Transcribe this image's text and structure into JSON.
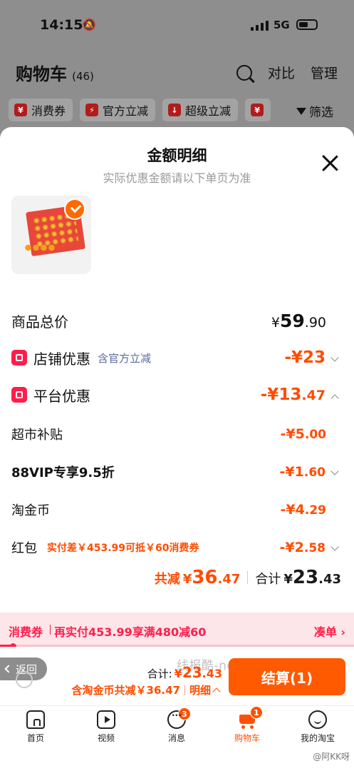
{
  "status_bar": {
    "time": "14:15",
    "network": "5G"
  },
  "cart_header": {
    "title": "购物车",
    "count": "(46)",
    "compare": "对比",
    "manage": "管理"
  },
  "filter_chips": [
    {
      "icon_text": "¥",
      "label": "消费券"
    },
    {
      "icon_text": "⚡",
      "label": "官方立减"
    },
    {
      "icon_text": "↓",
      "label": "超级立减"
    },
    {
      "icon_text": "¥",
      "label": ""
    }
  ],
  "filter_label": "筛选",
  "sheet": {
    "title": "金额明细",
    "subtitle": "实际优惠金额请以下单页为准",
    "total_price": {
      "label": "商品总价",
      "currency": "¥",
      "int": "59",
      "dec": ".90"
    },
    "shop_discount": {
      "label": "店铺优惠",
      "note": "含官方立减",
      "amount": "-¥23"
    },
    "platform_discount": {
      "label": "平台优惠",
      "amount_int": "-¥13",
      "amount_dec": ".47"
    },
    "items": [
      {
        "label": "超市补贴",
        "amount_int": "-¥5",
        "amount_dec": ".00",
        "note": "",
        "chevron": false
      },
      {
        "label": "88VIP专享9.5折",
        "amount_int": "-¥1",
        "amount_dec": ".60",
        "note": "",
        "chevron": true
      },
      {
        "label": "淘金币",
        "amount_int": "-¥4",
        "amount_dec": ".29",
        "note": "",
        "chevron": false
      },
      {
        "label": "红包",
        "amount_int": "-¥2",
        "amount_dec": ".58",
        "note": "实付差￥453.99可抵￥60消费券",
        "chevron": true
      }
    ],
    "summary": {
      "saved_label": "共减",
      "saved_currency": "¥",
      "saved_int": "36",
      "saved_dec": ".47",
      "total_label": "合计",
      "total_currency": "¥",
      "total_int": "23",
      "total_dec": ".43"
    }
  },
  "coupon_bar": {
    "tag": "消费券",
    "message": "再实付453.99享满480减60",
    "link": "凑单 ›",
    "progress": 0.04
  },
  "checkout": {
    "back_label": "返回",
    "sum_label": "合计:",
    "sum_currency": "¥",
    "sum_int": "23",
    "sum_dec": ".43",
    "saved_text": "含淘金币共减￥36.47",
    "detail_label": "明细",
    "pay_button": "结算(1)",
    "watermark": "线报酷-new.xianbao.fun"
  },
  "tabbar": [
    {
      "label": "首页",
      "icon": "home-icon",
      "badge": ""
    },
    {
      "label": "视频",
      "icon": "video-icon",
      "badge": ""
    },
    {
      "label": "消息",
      "icon": "message-icon",
      "badge": "3"
    },
    {
      "label": "购物车",
      "icon": "cart-icon",
      "badge": "1"
    },
    {
      "label": "我的淘宝",
      "icon": "profile-icon",
      "badge": ""
    }
  ],
  "weibo_mark": "@阿KK呀",
  "colors": {
    "accent": "#ff4c00",
    "pay": "#ff5a00",
    "coupon_red": "#ff1e4a"
  }
}
